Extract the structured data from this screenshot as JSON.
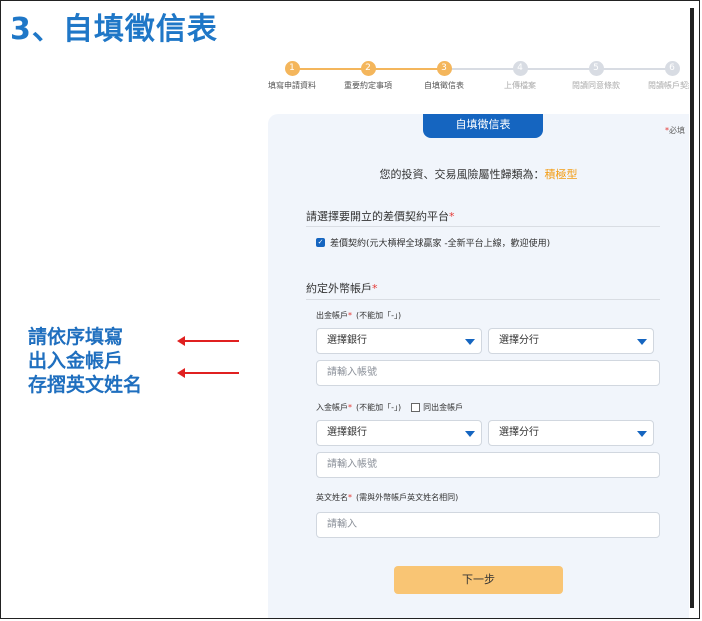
{
  "slide": {
    "title": "3、自填徵信表",
    "annotation": [
      "請依序填寫",
      "出入金帳戶",
      "存摺英文姓名"
    ]
  },
  "stepper": {
    "steps": [
      {
        "number": "1",
        "label": "填寫申請資料",
        "state": "active"
      },
      {
        "number": "2",
        "label": "重要約定事項",
        "state": "active"
      },
      {
        "number": "3",
        "label": "自填徵信表",
        "state": "active"
      },
      {
        "number": "4",
        "label": "上傳檔案",
        "state": "pending"
      },
      {
        "number": "5",
        "label": "閱讀同意條款",
        "state": "pending"
      },
      {
        "number": "6",
        "label": "閱讀帳戶契約",
        "state": "pending"
      }
    ]
  },
  "form": {
    "tab_title": "自填徵信表",
    "required_star": "*",
    "required_note": "必填",
    "risk_prefix": "您的投資、交易風險屬性歸類為：",
    "risk_value": "積極型",
    "platform_section": "請選擇要開立的差價契約平台",
    "platform_option": "差價契約(元大槓桿全球贏家 -全新平台上線，歡迎使用)",
    "fx_section": "約定外幣帳戶",
    "outbound": {
      "label": "出金帳戶",
      "note": "(不能加「-」)",
      "bank_select": "選擇銀行",
      "branch_select": "選擇分行",
      "account_placeholder": "請輸入帳號"
    },
    "inbound": {
      "label": "入金帳戶",
      "note": "(不能加「-」)",
      "same_as_outbound": "同出金帳戶",
      "bank_select": "選擇銀行",
      "branch_select": "選擇分行",
      "account_placeholder": "請輸入帳號"
    },
    "english_name": {
      "label": "英文姓名",
      "note": "(需與外幣帳戶英文姓名相同)",
      "placeholder": "請輸入"
    },
    "next_button": "下一步"
  },
  "colors": {
    "title_blue": "#1f77c7",
    "primary": "#1565c0",
    "accent_orange": "#f4b65c",
    "button_orange": "#f9c574",
    "required_red": "#e53935",
    "arrow_red": "#e02020"
  }
}
